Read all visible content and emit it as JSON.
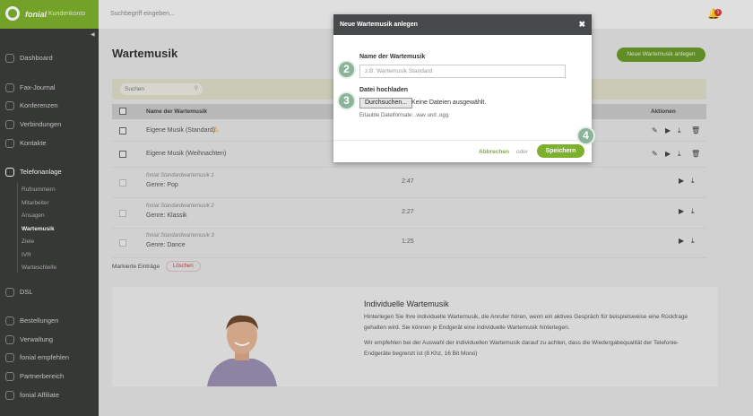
{
  "topbar": {
    "brand": "fonial",
    "brand_sub": "Kundenkonto",
    "search_placeholder": "Suchbegriff eingeben...",
    "notification_count": "1"
  },
  "sidebar": {
    "items": [
      {
        "label": "Dashboard"
      },
      {
        "label": "Fax-Journal"
      },
      {
        "label": "Konferenzen"
      },
      {
        "label": "Verbindungen"
      },
      {
        "label": "Kontakte"
      },
      {
        "label": "Telefonanlage"
      },
      {
        "label": "DSL"
      },
      {
        "label": "Bestellungen"
      },
      {
        "label": "Verwaltung"
      },
      {
        "label": "fonial empfehlen"
      },
      {
        "label": "Partnerbereich"
      },
      {
        "label": "fonial Affiliate"
      }
    ],
    "sub_items": [
      "Rufnummern",
      "Mitarbeiter",
      "Ansagen",
      "Wartemusik",
      "Ziele",
      "IVR",
      "Warteschleife"
    ]
  },
  "page": {
    "title": "Wartemusik",
    "new_button": "Neue Wartemusik anlegen",
    "filter_placeholder": "Suchen",
    "table": {
      "col_name": "Name der Wartemusik",
      "col_actions": "Aktionen",
      "rows": [
        {
          "name": "Eigene Musik (Standard)",
          "small": "",
          "genre": "",
          "duration": ""
        },
        {
          "name": "Eigene Musik (Weihnachten)",
          "small": "",
          "genre": "",
          "duration": ""
        },
        {
          "name": "",
          "small": "fonial Standardwartemusik 1",
          "genre": "Genre: Pop",
          "duration": "2:47"
        },
        {
          "name": "",
          "small": "fonial Standardwartemusik 2",
          "genre": "Genre: Klassik",
          "duration": "2:27"
        },
        {
          "name": "",
          "small": "fonial Standardwartemusik 3",
          "genre": "Genre: Dance",
          "duration": "1:25"
        }
      ]
    },
    "marked_label": "Markierte Einträge",
    "delete_label": "Löschen",
    "info": {
      "title": "Individuelle Wartemusik",
      "p1": "Hinterlegen Sie Ihre individuelle Wartemusik, die Anrufer hören, wenn ein aktives Gespräch für beispielsweise eine Rückfrage gehalten wird. Sie können je Endgerät eine individuelle Wartemusik hinterlegen.",
      "p2": "Wir empfehlen bei der Auswahl der individuellen Wartemusik darauf zu achten, dass die Wiedergabequalität der Telefonie-Endgeräte begrenzt ist (8 Khz, 16 Bit Mono)"
    }
  },
  "modal": {
    "title": "Neue Wartemusik anlegen",
    "name_label": "Name der Wartemusik",
    "name_placeholder": "z.B. Wartemusik Standard",
    "upload_label": "Datei hochladen",
    "browse_button": "Durchsuchen...",
    "file_status": "Keine Dateien ausgewählt.",
    "hint": "Erlaubte Dateiformate: .wav und .ogg.",
    "cancel": "Abbrechen",
    "or": "oder",
    "save": "Speichern"
  },
  "steps": [
    "2",
    "3",
    "4"
  ],
  "colors": {
    "brand_green": "#7db02d",
    "sidebar": "#3a3d3a",
    "step_badge": "#8cb49a"
  }
}
